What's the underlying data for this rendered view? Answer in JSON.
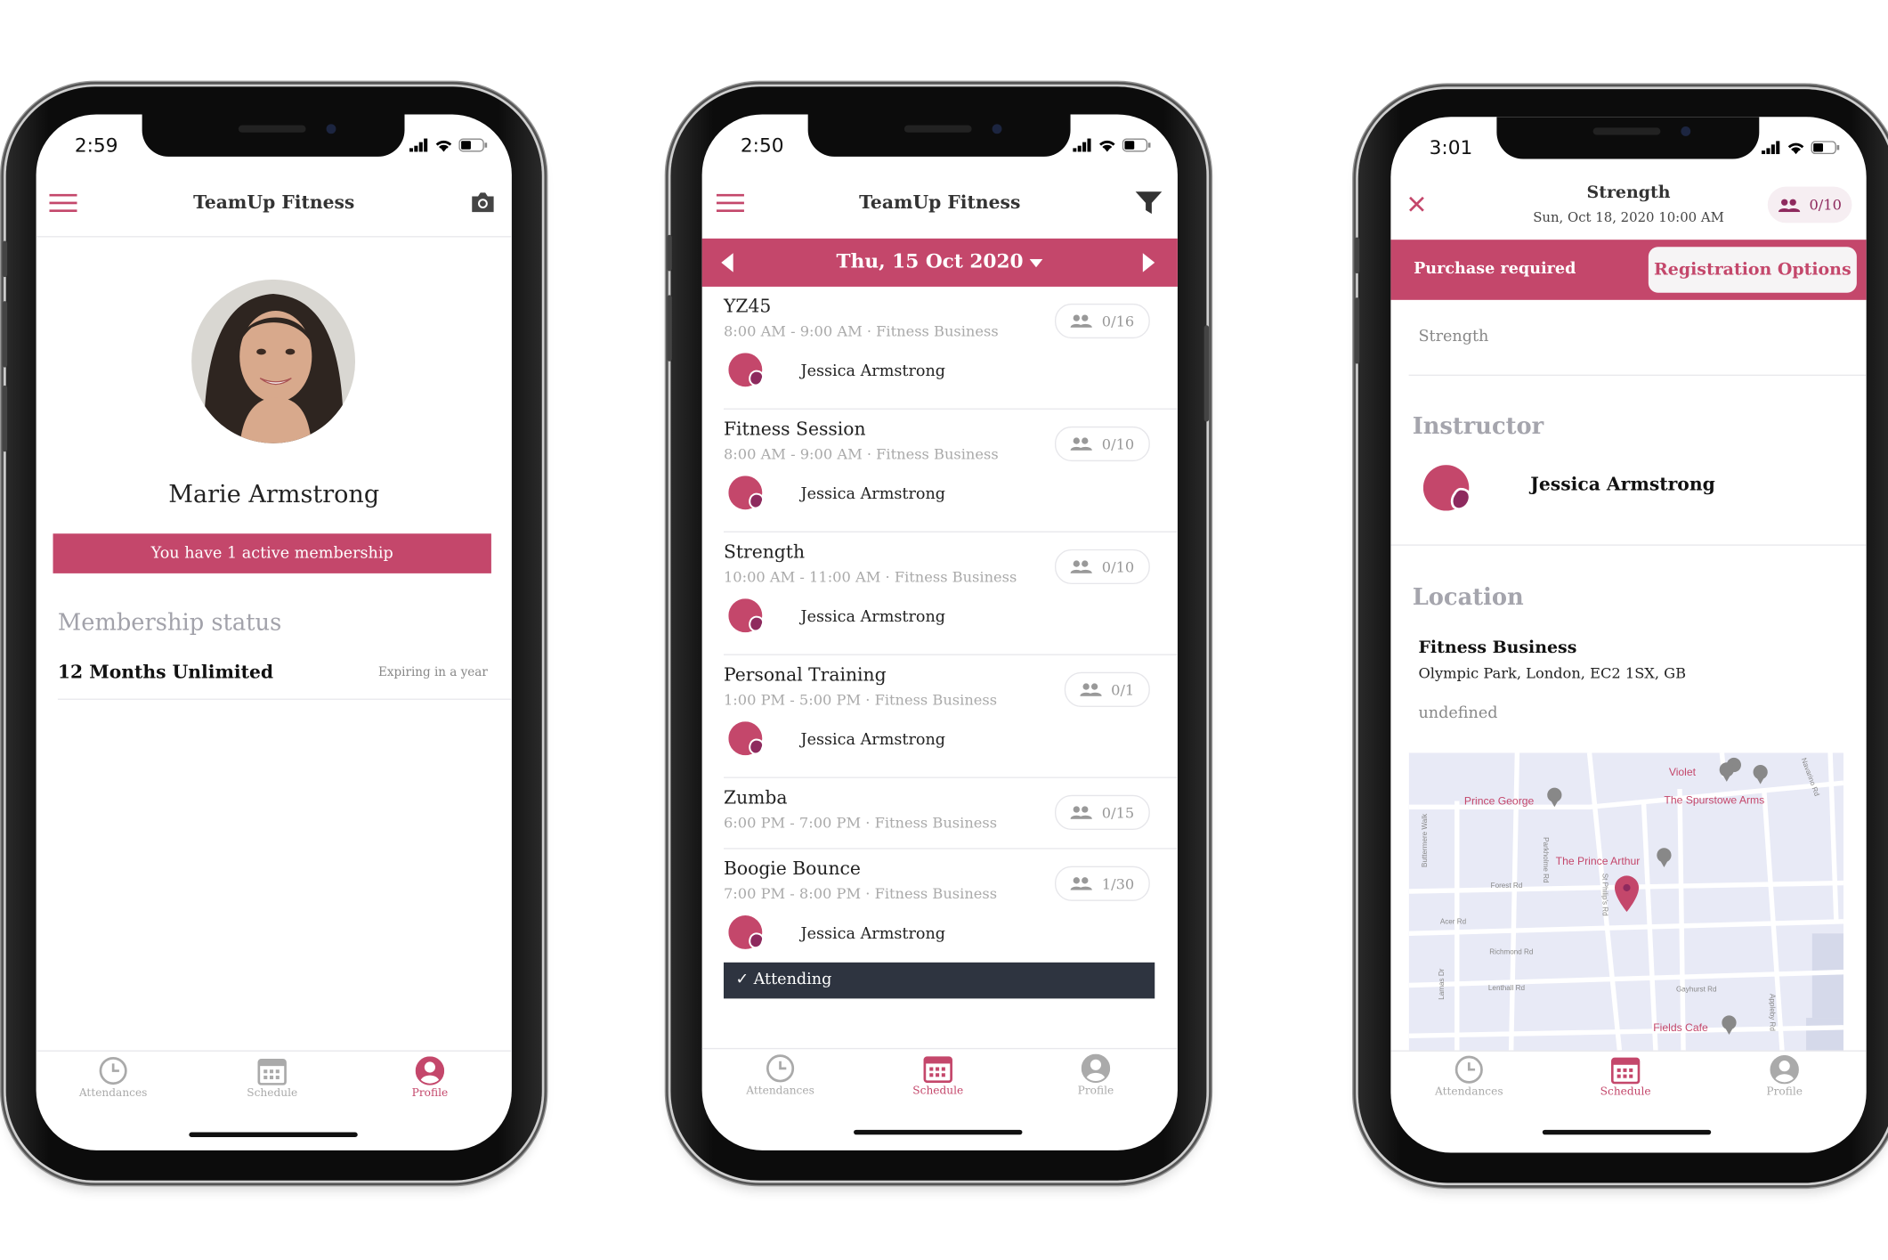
{
  "colors": {
    "accent": "#c4476b",
    "accent_dark": "#8e2a5e",
    "attending_bar": "#2e3440",
    "map_bg": "#e8eaf6"
  },
  "profile_screen": {
    "status_time": "2:59",
    "header": {
      "title": "TeamUp Fitness",
      "menu_icon": "hamburger-icon",
      "right_icon": "camera-icon"
    },
    "user_name": "Marie Armstrong",
    "membership_banner": "You have 1 active membership",
    "section_title": "Membership status",
    "membership": {
      "name": "12 Months Unlimited",
      "expiry": "Expiring in a year"
    },
    "tabs": [
      {
        "label": "Attendances",
        "icon": "clock-icon"
      },
      {
        "label": "Schedule",
        "icon": "calendar-icon"
      },
      {
        "label": "Profile",
        "icon": "user-icon",
        "active": true
      }
    ]
  },
  "schedule_screen": {
    "status_time": "2:50",
    "header": {
      "title": "TeamUp Fitness",
      "menu_icon": "hamburger-icon",
      "right_icon": "filter-icon"
    },
    "date": "Thu, 15 Oct 2020",
    "events": [
      {
        "title": "YZ45",
        "time": "8:00 AM - 9:00 AM · Fitness Business",
        "capacity": "0/16",
        "instructor": "Jessica Armstrong"
      },
      {
        "title": "Fitness Session",
        "time": "8:00 AM - 9:00 AM · Fitness Business",
        "capacity": "0/10",
        "instructor": "Jessica Armstrong"
      },
      {
        "title": "Strength",
        "time": "10:00 AM - 11:00 AM · Fitness Business",
        "capacity": "0/10",
        "instructor": "Jessica Armstrong"
      },
      {
        "title": "Personal Training",
        "time": "1:00 PM - 5:00 PM · Fitness Business",
        "capacity": "0/1",
        "instructor": "Jessica Armstrong"
      },
      {
        "title": "Zumba",
        "time": "6:00 PM - 7:00 PM · Fitness Business",
        "capacity": "0/15"
      },
      {
        "title": "Boogie Bounce",
        "time": "7:00 PM - 8:00 PM · Fitness Business",
        "capacity": "1/30",
        "instructor": "Jessica Armstrong",
        "status": "Attending"
      }
    ],
    "tabs": [
      {
        "label": "Attendances",
        "icon": "clock-icon"
      },
      {
        "label": "Schedule",
        "icon": "calendar-icon",
        "active": true
      },
      {
        "label": "Profile",
        "icon": "user-icon"
      }
    ]
  },
  "detail_screen": {
    "status_time": "3:01",
    "title": "Strength",
    "subtitle": "Sun, Oct 18, 2020 10:00 AM",
    "capacity": "0/10",
    "purchase_text": "Purchase required",
    "registration_button": "Registration Options",
    "description": "Strength",
    "instructor_heading": "Instructor",
    "instructor": "Jessica Armstrong",
    "location_heading": "Location",
    "location": {
      "name": "Fitness Business",
      "address": "Olympic Park, London, EC2 1SX, GB",
      "extra": "undefined"
    },
    "map": {
      "places": [
        "Violet",
        "Prince George",
        "The Spurstowe Arms",
        "The Prince Arthur",
        "Fields Cafe"
      ],
      "streets": [
        "Buttermere Walk",
        "Parkholme Rd",
        "St Philip's Rd",
        "Navarino Rd",
        "Forest Rd",
        "Acer Rd",
        "Richmond Rd",
        "Lenthall Rd",
        "Gayhurst Rd",
        "Lamas Dr",
        "Appleby Rd"
      ]
    },
    "tabs": [
      {
        "label": "Attendances",
        "icon": "clock-icon"
      },
      {
        "label": "Schedule",
        "icon": "calendar-icon",
        "active": true
      },
      {
        "label": "Profile",
        "icon": "user-icon"
      }
    ]
  }
}
